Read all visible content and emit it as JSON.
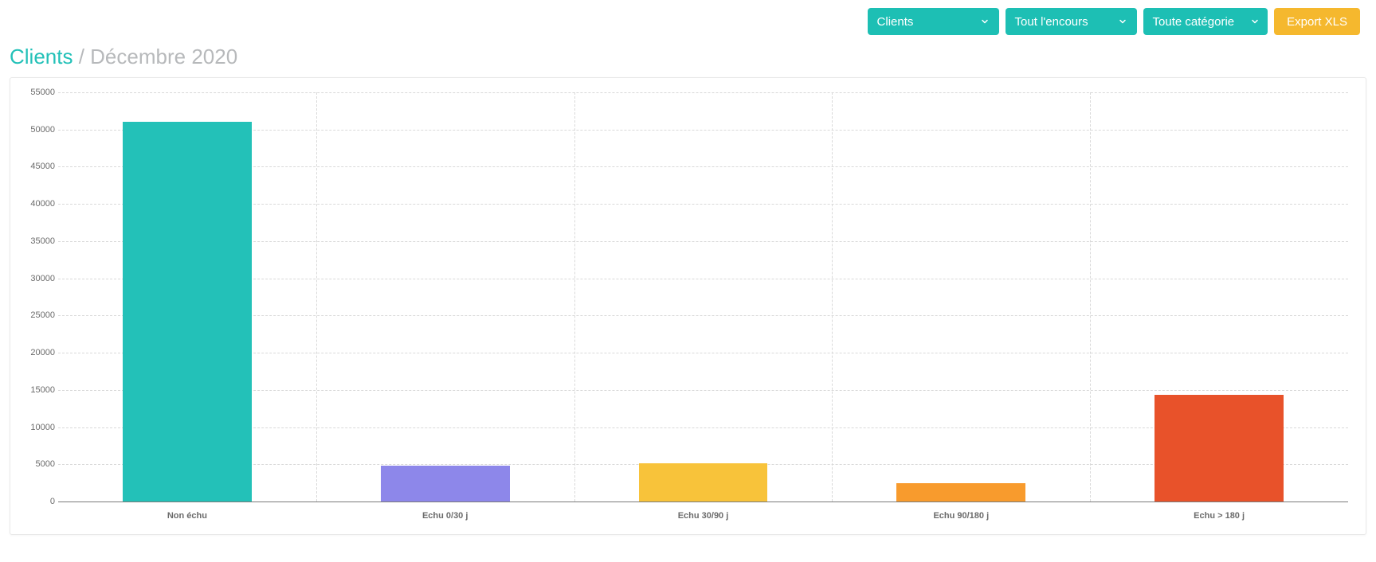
{
  "toolbar": {
    "clients": "Clients",
    "encours": "Tout l'encours",
    "categorie": "Toute catégorie",
    "export": "Export XLS"
  },
  "title": {
    "part1": "Clients",
    "sep": " / ",
    "part2": "Décembre 2020"
  },
  "chart_data": {
    "type": "bar",
    "categories": [
      "Non échu",
      "Echu 0/30 j",
      "Echu 30/90 j",
      "Echu 90/180 j",
      "Echu > 180 j"
    ],
    "values": [
      51000,
      4800,
      5100,
      2500,
      14300
    ],
    "colors": [
      "#23c1b8",
      "#8d87ea",
      "#f8c33a",
      "#f89b2d",
      "#e8522a"
    ],
    "ylim": [
      0,
      55000
    ],
    "yticks": [
      0,
      5000,
      10000,
      15000,
      20000,
      25000,
      30000,
      35000,
      40000,
      45000,
      50000,
      55000
    ],
    "title": "",
    "xlabel": "",
    "ylabel": ""
  }
}
